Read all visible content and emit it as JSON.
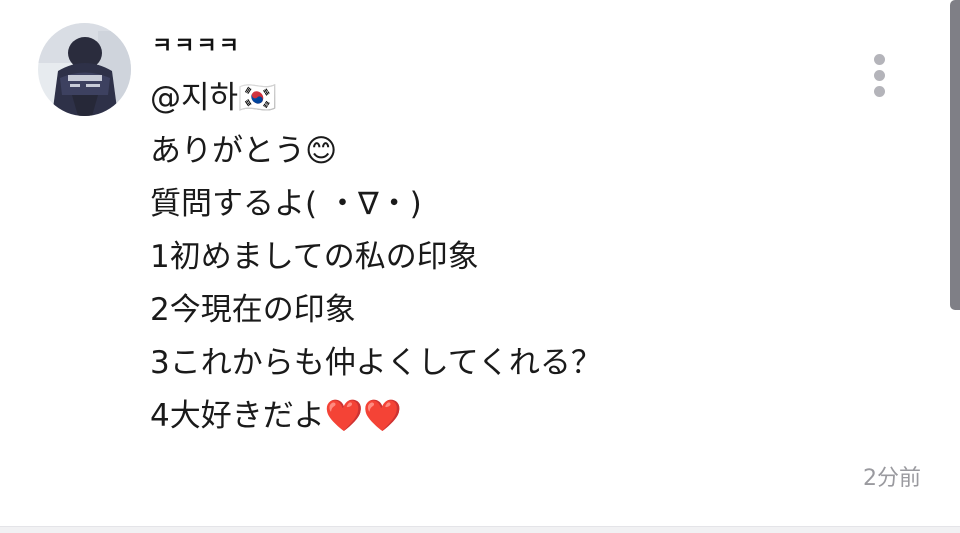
{
  "comment": {
    "author": "ㅋㅋㅋㅋ",
    "lines": [
      "@지하🇰🇷",
      "ありがとう😊",
      "質問するよ( ・∇・)",
      "1初めましての私の印象",
      "2今現在の印象",
      "3これからも仲よくしてくれる？",
      "4大好きだよ❤️❤️"
    ],
    "timestamp": "2分前",
    "avatar_icon": "profile-photo",
    "more_icon": "more-vertical-icon"
  },
  "colors": {
    "background": "#ffffff",
    "text": "#1a1a1a",
    "muted": "#9a9a9f",
    "icon": "#b4b4ba",
    "scrollbar": "#7f7f86"
  }
}
